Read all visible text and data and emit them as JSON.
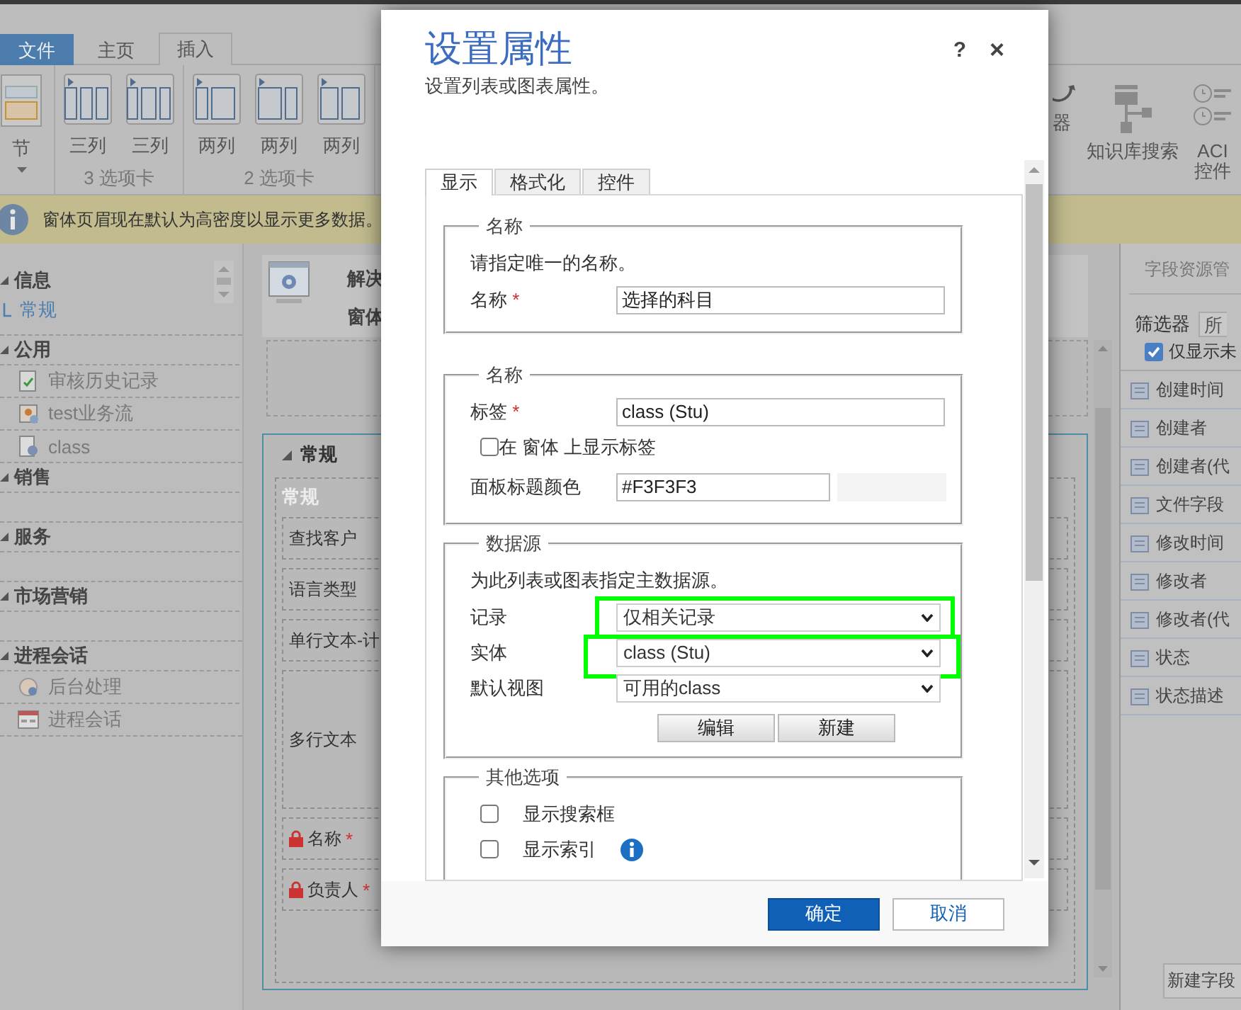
{
  "ribbon": {
    "tabs": [
      {
        "label": "文件",
        "kind": "file",
        "selected": false
      },
      {
        "label": "主页",
        "kind": "tab",
        "selected": false
      },
      {
        "label": "插入",
        "kind": "tab",
        "selected": true
      }
    ],
    "groups": [
      {
        "buttons": [
          {
            "label": "节",
            "kind": "section",
            "dropdown": true
          }
        ]
      },
      {
        "label": "3 选项卡",
        "buttons": [
          {
            "label": "三列",
            "kind": "three-column"
          },
          {
            "label": "三列",
            "kind": "three-column"
          }
        ]
      },
      {
        "label": "2 选项卡",
        "buttons": [
          {
            "label": "两列",
            "kind": "two-column"
          },
          {
            "label": "两列",
            "kind": "two-column"
          },
          {
            "label": "两列",
            "kind": "two-column"
          }
        ]
      }
    ],
    "tools": [
      {
        "label": "器",
        "kind": "timer"
      },
      {
        "label": "知识库搜索",
        "kind": "tree"
      },
      {
        "label": "ACI 控件",
        "kind": "list"
      }
    ]
  },
  "info_bar": {
    "message": "窗体页眉现在默认为高密度以显示更多数据。"
  },
  "left_nav": {
    "sections": [
      {
        "title": "信息",
        "children": [
          {
            "label": "常规",
            "kind": "link"
          }
        ]
      },
      {
        "title": "公用",
        "children": [
          {
            "label": "审核历史记录",
            "kind": "item"
          },
          {
            "label": "test业务流",
            "kind": "item"
          },
          {
            "label": "class",
            "kind": "item"
          }
        ]
      },
      {
        "title": "销售"
      },
      {
        "title": "服务"
      },
      {
        "title": "市场营销"
      },
      {
        "title": "进程会话",
        "children": [
          {
            "label": "后台处理",
            "kind": "item"
          },
          {
            "label": "进程会话",
            "kind": "item"
          }
        ]
      }
    ]
  },
  "form_canvas": {
    "header": {
      "lines": [
        "解决",
        "窗体"
      ]
    },
    "section": {
      "title": "常规",
      "tab_label": "常规",
      "fields": [
        {
          "label": "查找客户",
          "kind": "field",
          "locked": false
        },
        {
          "label": "语言类型",
          "kind": "field",
          "locked": false
        },
        {
          "label": "单行文本-计",
          "kind": "field",
          "locked": false
        },
        {
          "label": "多行文本",
          "kind": "multiline",
          "locked": false
        },
        {
          "label": "名称",
          "kind": "field",
          "locked": true,
          "mark": "*"
        },
        {
          "label": "负责人",
          "kind": "field",
          "locked": true,
          "mark": "*"
        }
      ]
    }
  },
  "field_panel": {
    "title": "字段资源管",
    "filter_label": "筛选器",
    "filter_value": "所",
    "only_unused": {
      "label": "仅显示未",
      "checked": true
    },
    "fields": [
      "创建时间",
      "创建者",
      "创建者(代",
      "文件字段",
      "修改时间",
      "修改者",
      "修改者(代",
      "状态",
      "状态描述"
    ],
    "new_button": "新建字段"
  },
  "dialog": {
    "title": "设置属性",
    "subtitle": "设置列表或图表属性。",
    "help": "?",
    "close": "×",
    "tabs": [
      {
        "label": "显示",
        "selected": true
      },
      {
        "label": "格式化",
        "selected": false
      },
      {
        "label": "控件",
        "selected": false
      }
    ],
    "groups": [
      {
        "legend": "名称",
        "rows": [
          {
            "kind": "note",
            "text": "请指定唯一的名称。"
          },
          {
            "kind": "text",
            "label": "名称",
            "mark": "*",
            "value": "选择的科目"
          }
        ]
      },
      {
        "legend": "名称",
        "rows": [
          {
            "kind": "text",
            "label": "标签",
            "mark": "*",
            "value": "class (Stu)"
          },
          {
            "kind": "checkbox",
            "label": "在 窗体 上显示标签",
            "checked": false
          },
          {
            "kind": "color",
            "label": "面板标题颜色",
            "value": "#F3F3F3",
            "color": "#f3f3f3"
          }
        ]
      },
      {
        "legend": "数据源",
        "rows": [
          {
            "kind": "note",
            "text": "为此列表或图表指定主数据源。"
          },
          {
            "kind": "select",
            "label": "记录",
            "value": "仅相关记录",
            "highlighted": true
          },
          {
            "kind": "select",
            "label": "实体",
            "value": "class (Stu)",
            "highlighted": true
          },
          {
            "kind": "select",
            "label": "默认视图",
            "value": "可用的class",
            "highlighted": false
          },
          {
            "kind": "buttons",
            "buttons": [
              "编辑",
              "新建"
            ]
          }
        ]
      },
      {
        "legend": "其他选项",
        "rows": [
          {
            "kind": "option",
            "label": "显示搜索框",
            "checked": false,
            "info": false
          },
          {
            "kind": "option",
            "label": "显示索引",
            "checked": false,
            "info": true
          }
        ]
      }
    ],
    "buttons": [
      {
        "label": "确定",
        "primary": true
      },
      {
        "label": "取消",
        "primary": false
      }
    ]
  }
}
